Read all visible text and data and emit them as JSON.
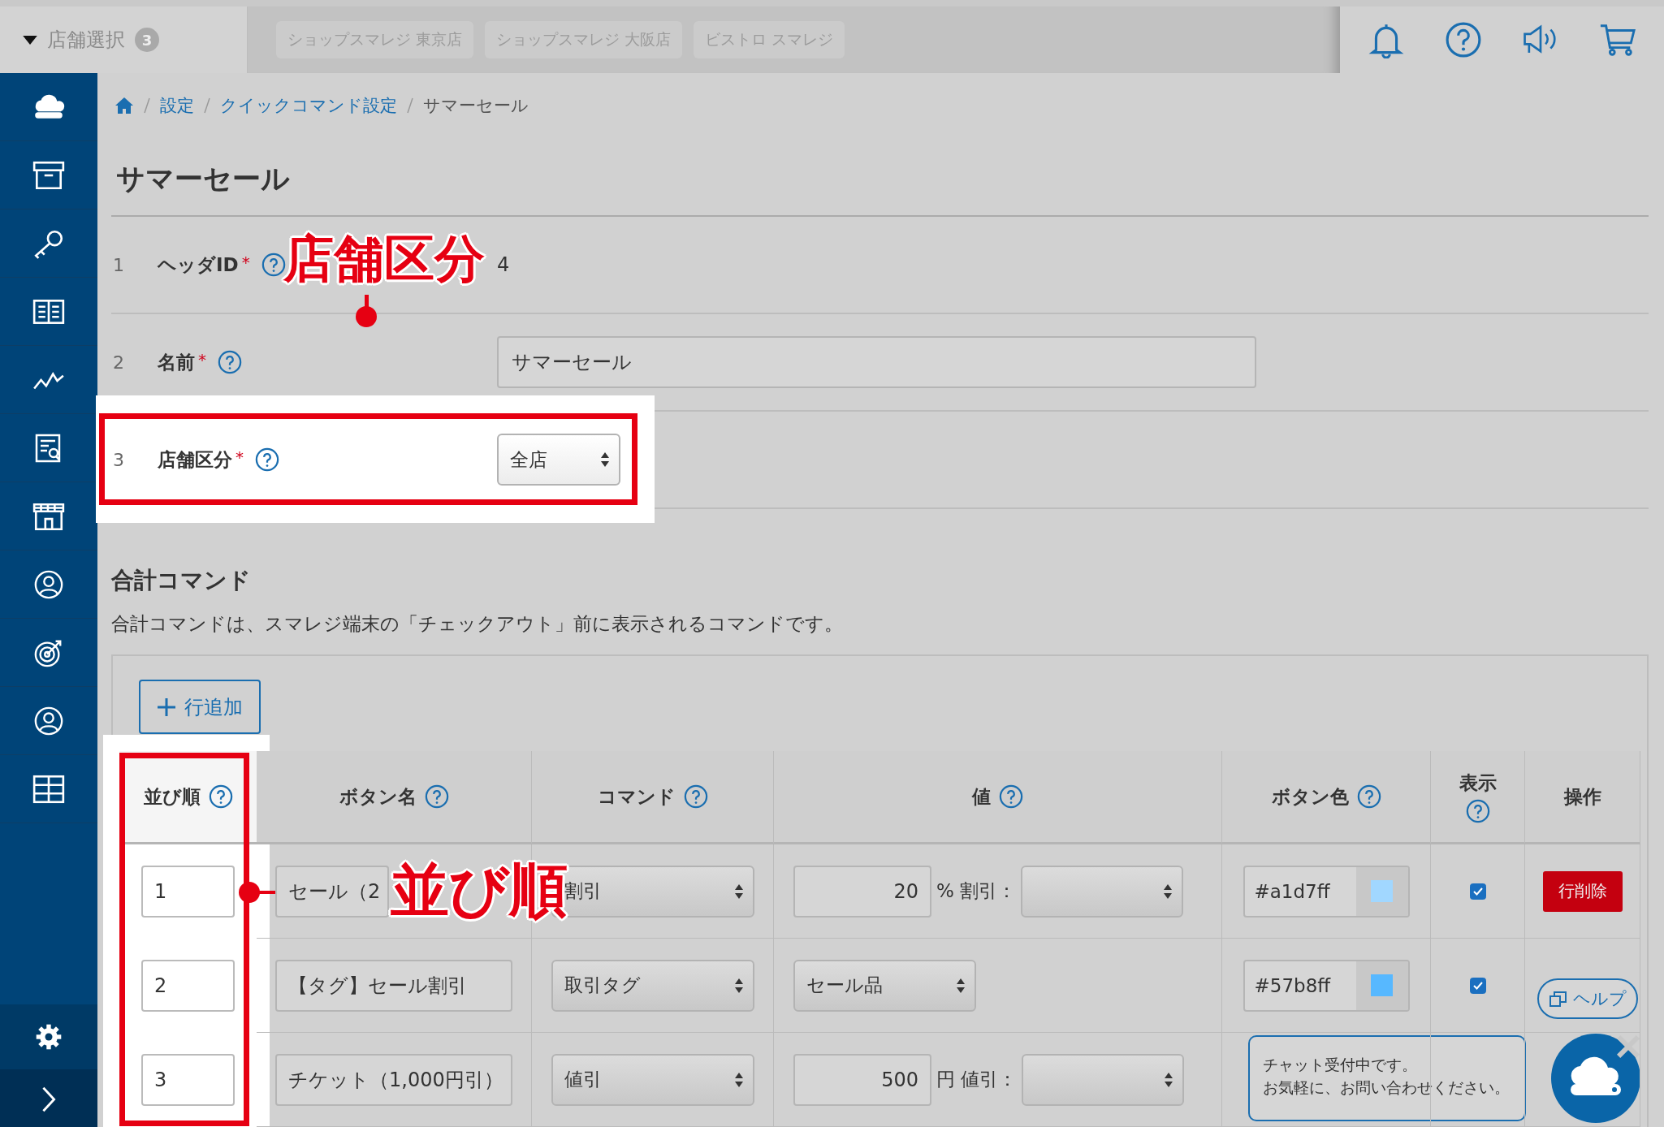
{
  "store_selector": {
    "label": "店舗選択",
    "count": "3"
  },
  "store_tabs": [
    "ショップスマレジ 東京店",
    "ショップスマレジ 大阪店",
    "ビストロ スマレジ"
  ],
  "breadcrumb": [
    "設定",
    "クイックコマンド設定",
    "サマーセール"
  ],
  "title": "サマーセール",
  "fields": [
    {
      "number": "1",
      "label": "ヘッダID",
      "required_mark": "*",
      "help": true,
      "kind": "text",
      "value": "4",
      "highlighted": false
    },
    {
      "number": "2",
      "label": "名前",
      "required_mark": "*",
      "help": true,
      "kind": "input",
      "value": "サマーセール",
      "highlighted": false
    },
    {
      "number": "3",
      "label": "店舗区分",
      "required_mark": "*",
      "help": true,
      "kind": "select",
      "value": "全店",
      "highlighted": true
    }
  ],
  "section": {
    "title": "合計コマンド",
    "description": "合計コマンドは、スマレジ端末の「チェックアウト」前に表示されるコマンドです。"
  },
  "add_row_button": "行追加",
  "table": {
    "columns": [
      {
        "label": "並び順",
        "help": true,
        "highlighted": true
      },
      {
        "label": "ボタン名",
        "help": true,
        "highlighted": false
      },
      {
        "label": "コマンド",
        "help": true,
        "highlighted": false
      },
      {
        "label": "値",
        "help": true,
        "highlighted": false
      },
      {
        "label": "ボタン色",
        "help": true,
        "highlighted": false
      },
      {
        "label": "表示",
        "help": true,
        "highlighted": false,
        "stacked": true
      },
      {
        "label": "操作",
        "help": false,
        "highlighted": false
      }
    ],
    "rows": [
      {
        "order": "1",
        "button_name": "セール（2",
        "command": "割引",
        "value": {
          "kind": "amount",
          "amount": "20",
          "suffix": "% 割引："
        },
        "color": "#a1d7ff",
        "visible": true,
        "delete_label": "行削除"
      },
      {
        "order": "2",
        "button_name": "【タグ】セール割引",
        "command": "取引タグ",
        "value": {
          "kind": "select",
          "value": "セール品"
        },
        "color": "#57b8ff",
        "visible": true
      },
      {
        "order": "3",
        "button_name": "チケット（1,000円引）",
        "command": "値引",
        "value": {
          "kind": "amount",
          "amount": "500",
          "suffix": "円 値引："
        }
      }
    ]
  },
  "annotations": [
    {
      "text": "店舗区分"
    },
    {
      "text": "並び順"
    }
  ],
  "help_button": "ヘルプ",
  "chat": {
    "lines": [
      "チャット受付中です。",
      "お気軽に、お問い合わせください。"
    ]
  }
}
